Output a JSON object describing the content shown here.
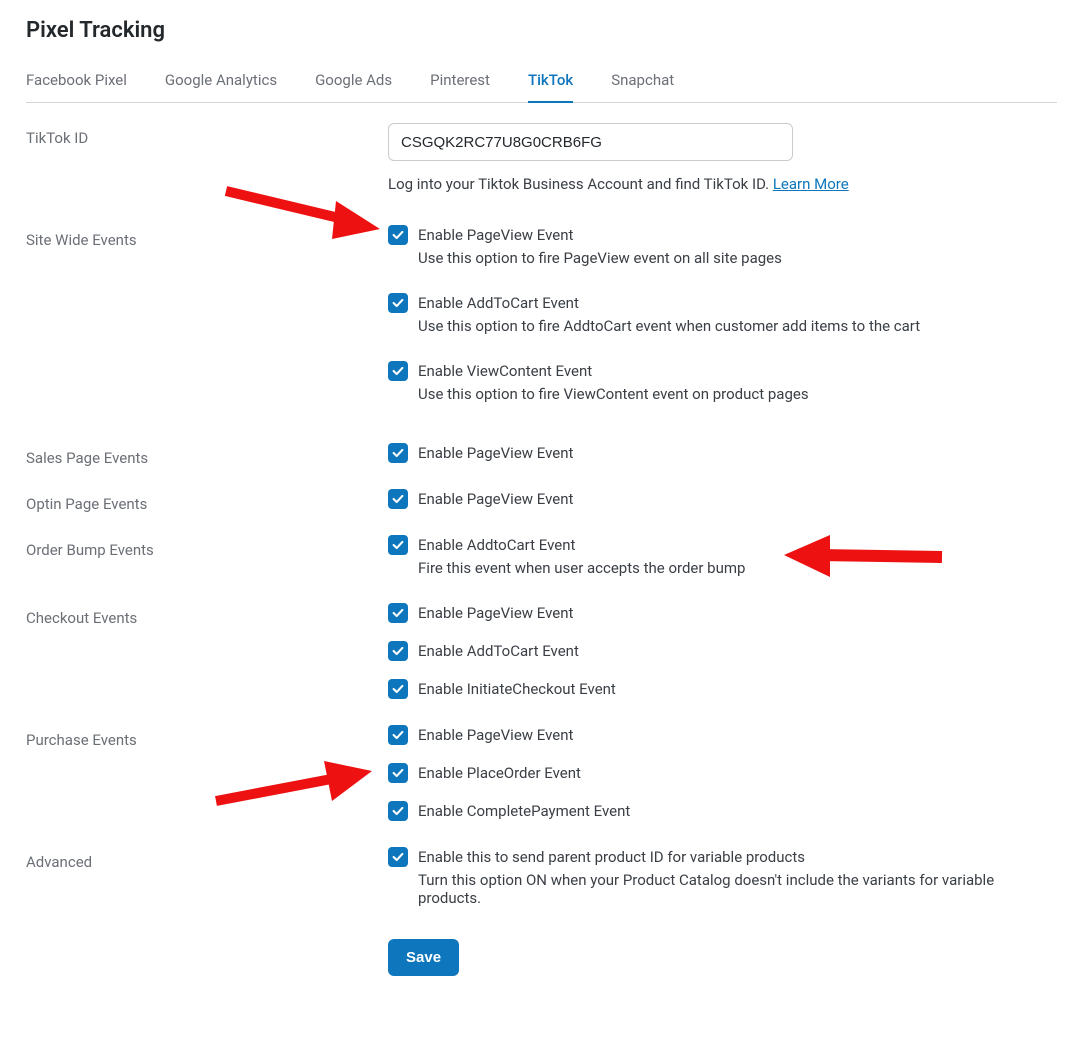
{
  "page_title": "Pixel Tracking",
  "tabs": [
    {
      "id": "fb",
      "label": "Facebook Pixel",
      "active": false
    },
    {
      "id": "ga",
      "label": "Google Analytics",
      "active": false
    },
    {
      "id": "gads",
      "label": "Google Ads",
      "active": false
    },
    {
      "id": "pin",
      "label": "Pinterest",
      "active": false
    },
    {
      "id": "tiktok",
      "label": "TikTok",
      "active": true
    },
    {
      "id": "snap",
      "label": "Snapchat",
      "active": false
    }
  ],
  "tiktok_id": {
    "label": "TikTok ID",
    "value": "CSGQK2RC77U8G0CRB6FG",
    "help_prefix": "Log into your Tiktok Business Account and find TikTok ID. ",
    "learn_more": "Learn More"
  },
  "sections": {
    "site_wide": {
      "label": "Site Wide Events",
      "items": [
        {
          "label": "Enable PageView Event",
          "desc": "Use this option to fire PageView event on all site pages"
        },
        {
          "label": "Enable AddToCart Event",
          "desc": "Use this option to fire AddtoCart event when customer add items to the cart"
        },
        {
          "label": "Enable ViewContent Event",
          "desc": "Use this option to fire ViewContent event on product pages"
        }
      ]
    },
    "sales_page": {
      "label": "Sales Page Events",
      "items": [
        {
          "label": "Enable PageView Event"
        }
      ]
    },
    "optin_page": {
      "label": "Optin Page Events",
      "items": [
        {
          "label": "Enable PageView Event"
        }
      ]
    },
    "order_bump": {
      "label": "Order Bump Events",
      "items": [
        {
          "label": "Enable AddtoCart Event",
          "desc": "Fire this event when user accepts the order bump"
        }
      ]
    },
    "checkout": {
      "label": "Checkout Events",
      "items": [
        {
          "label": "Enable PageView Event"
        },
        {
          "label": "Enable AddToCart Event"
        },
        {
          "label": "Enable InitiateCheckout Event"
        }
      ]
    },
    "purchase": {
      "label": "Purchase Events",
      "items": [
        {
          "label": "Enable PageView Event"
        },
        {
          "label": "Enable PlaceOrder Event"
        },
        {
          "label": "Enable CompletePayment Event"
        }
      ]
    },
    "advanced": {
      "label": "Advanced",
      "items": [
        {
          "label": "Enable this to send parent product ID for variable products",
          "desc": "Turn this option ON when your Product Catalog doesn't include the variants for variable products."
        }
      ]
    }
  },
  "save_label": "Save"
}
